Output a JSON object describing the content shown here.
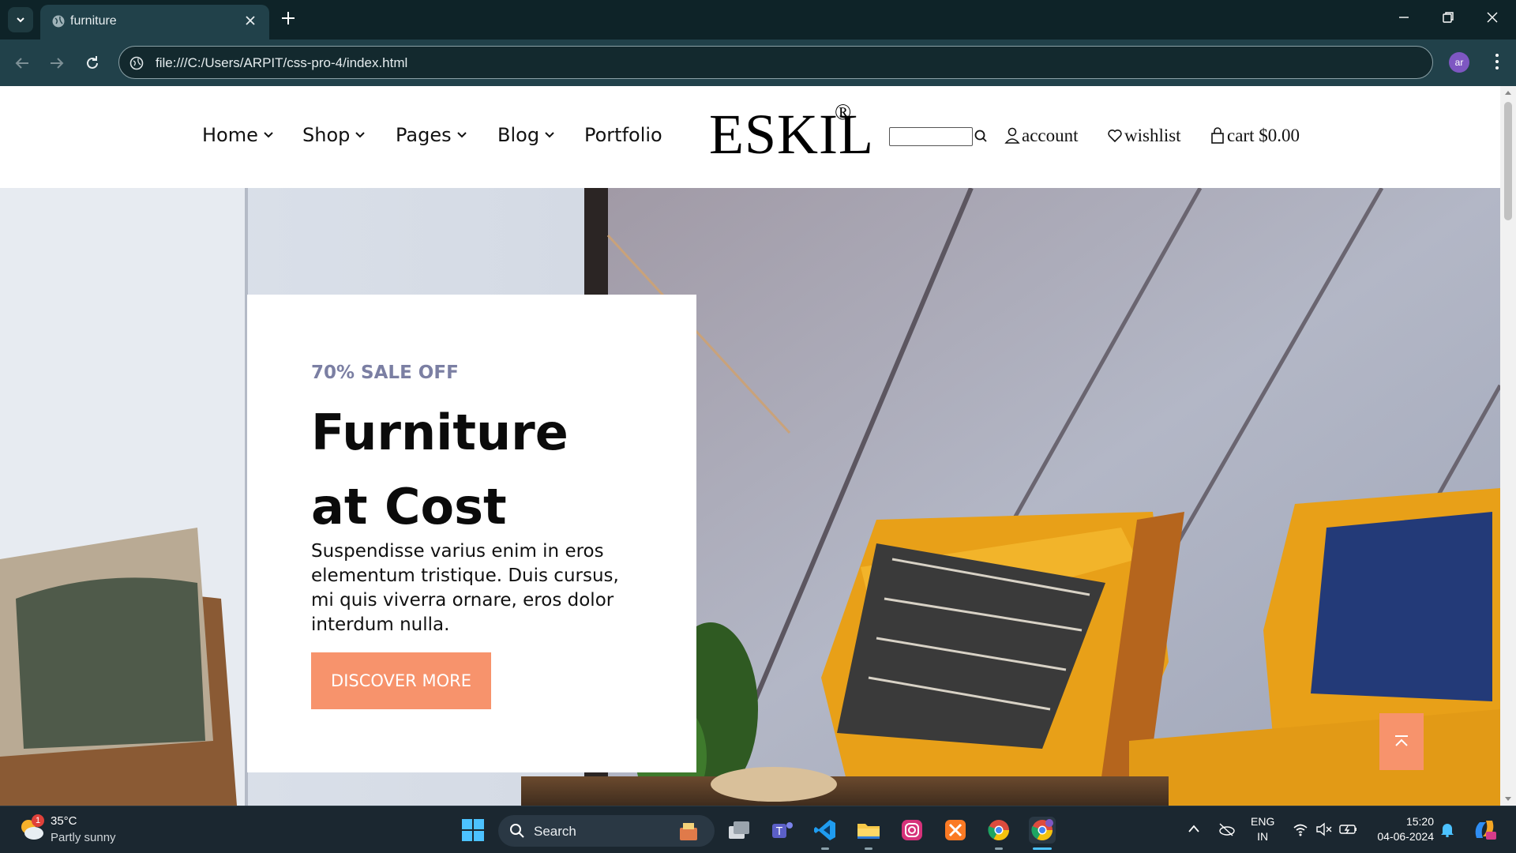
{
  "browser": {
    "tab_title": "furniture",
    "url": "file:///C:/Users/ARPIT/css-pro-4/index.html",
    "profile_initials": "ar"
  },
  "header": {
    "nav": [
      {
        "label": "Home",
        "dropdown": true
      },
      {
        "label": "Shop",
        "dropdown": true
      },
      {
        "label": "Pages",
        "dropdown": true
      },
      {
        "label": "Blog",
        "dropdown": true
      },
      {
        "label": "Portfolio",
        "dropdown": false
      }
    ],
    "logo": "ESKIL",
    "logo_mark": "®",
    "search_value": "",
    "account_label": "account",
    "wishlist_label": "wishlist",
    "cart_label": "cart $0.00"
  },
  "hero": {
    "eyebrow": "70% SALE OFF",
    "headline_line1": "Furniture",
    "headline_line2": "at Cost",
    "description": "Suspendisse varius enim in eros elementum tristique. Duis cursus, mi quis viverra ornare, eros dolor interdum nulla.",
    "cta_label": "DISCOVER MORE"
  },
  "colors": {
    "accent": "#f7936c",
    "eyebrow": "#7b7fa3",
    "browser_bg": "#0e2328",
    "toolbar_bg": "#21414a"
  },
  "taskbar": {
    "temperature": "35°C",
    "condition": "Partly sunny",
    "weather_badge": "1",
    "search_label": "Search",
    "language": "ENG",
    "region": "IN",
    "time": "15:20",
    "date": "04-06-2024",
    "apps": [
      "task-view-icon",
      "teams-icon",
      "vscode-icon",
      "file-explorer-icon",
      "instagram-icon",
      "xampp-icon",
      "chrome-icon",
      "chrome-profile-icon"
    ]
  }
}
